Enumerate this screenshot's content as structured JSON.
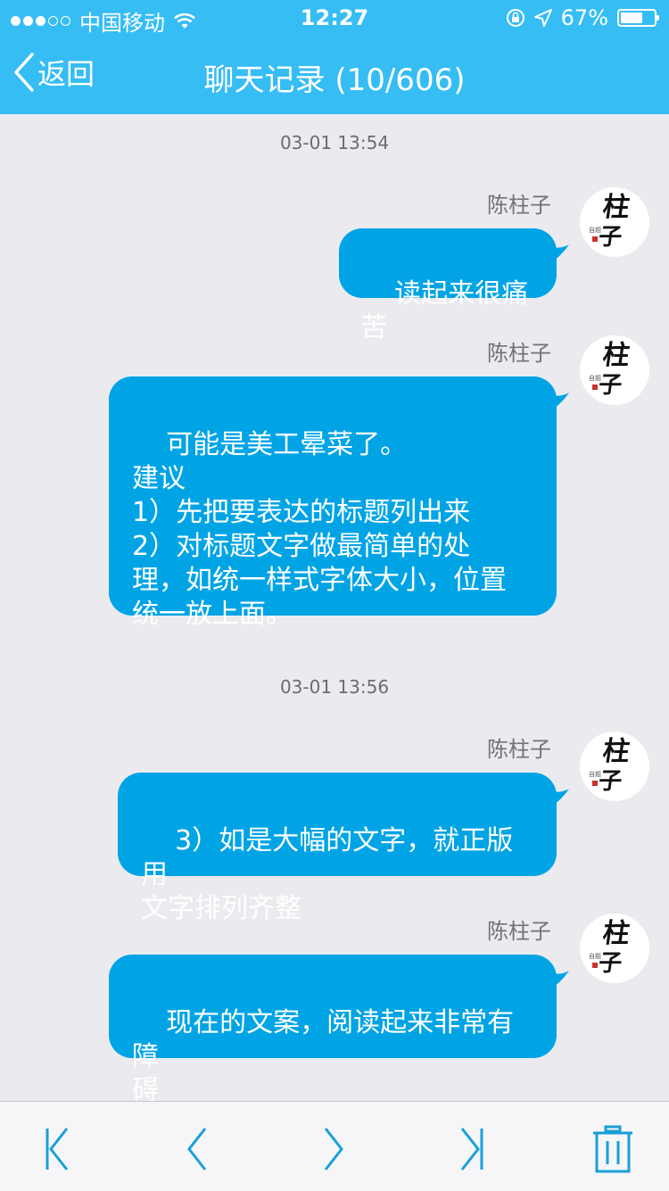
{
  "status_bar": {
    "carrier": "中国移动",
    "time": "12:27",
    "battery_percent_label": "67%",
    "battery_level": 0.67,
    "signal_bars_filled": 3,
    "signal_bars_total": 5
  },
  "nav": {
    "back_label": "返回",
    "title": "聊天记录 (10/606)"
  },
  "messages": [
    {
      "timestamp": "03-01 13:54",
      "sender": "陈柱子",
      "text": "读起来很痛苦"
    },
    {
      "sender": "陈柱子",
      "text": "可能是美工晕菜了。\n建议\n1）先把要表达的标题列出来\n2）对标题文字做最简单的处\n理，如统一样式字体大小，位置\n统一放上面。"
    },
    {
      "timestamp": "03-01 13:56",
      "sender": "陈柱子",
      "text": "3）如是大幅的文字，就正版用\n文字排列齐整"
    },
    {
      "sender": "陈柱子",
      "text": "现在的文案，阅读起来非常有障\n碍"
    }
  ],
  "avatar": {
    "glyph_top": "柱",
    "glyph_bottom": "子",
    "seal": "自题"
  },
  "colors": {
    "nav_bg": "#36bdf4",
    "bubble_bg": "#00a4e5",
    "chat_bg": "#ebebef",
    "toolbar_icon": "#1a9fd8"
  },
  "toolbar_icons": [
    "first-page-icon",
    "previous-page-icon",
    "next-page-icon",
    "last-page-icon",
    "trash-icon"
  ]
}
